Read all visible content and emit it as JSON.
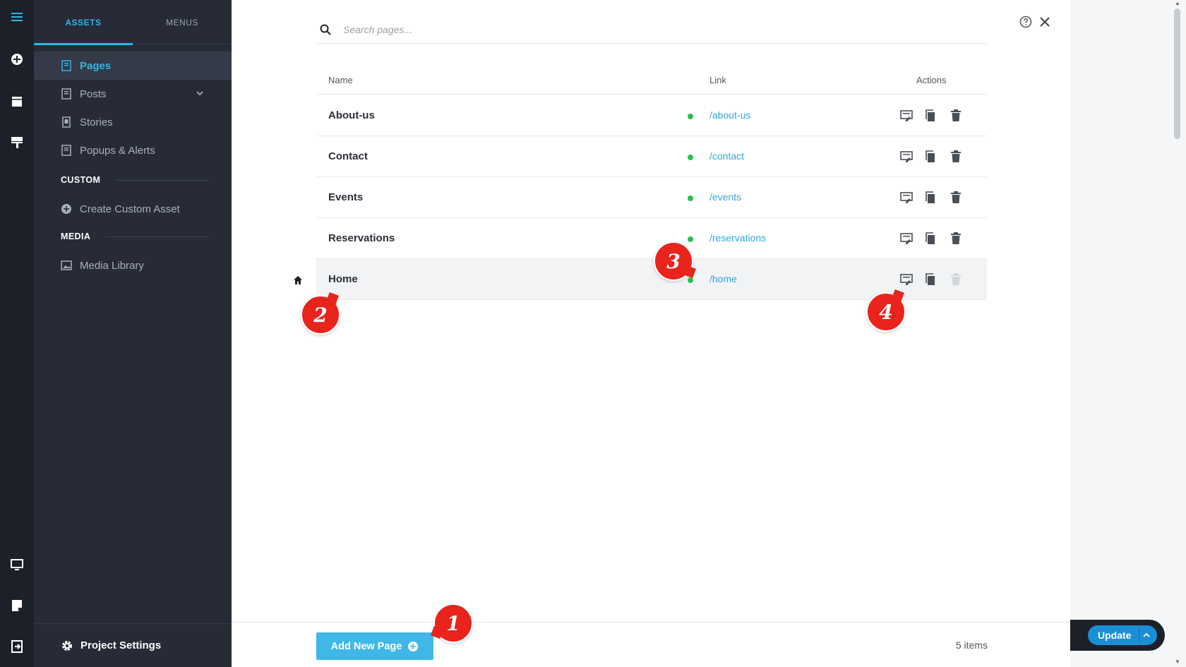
{
  "sidebar_rail": {
    "icons": [
      "menu-icon",
      "add-circle-icon",
      "page-icon",
      "paint-roller-icon",
      "desktop-icon",
      "note-icon",
      "exit-icon"
    ]
  },
  "assets_panel": {
    "tabs": [
      {
        "label": "ASSETS",
        "active": true
      },
      {
        "label": "MENUS",
        "active": false
      }
    ],
    "items": [
      {
        "label": "Pages",
        "active": true
      },
      {
        "label": "Posts",
        "expandable": true
      },
      {
        "label": "Stories"
      },
      {
        "label": "Popups & Alerts"
      }
    ],
    "custom_section": "CUSTOM",
    "custom_items": [
      {
        "label": "Create Custom Asset"
      }
    ],
    "media_section": "MEDIA",
    "media_items": [
      {
        "label": "Media Library"
      }
    ],
    "project_settings": "Project Settings"
  },
  "main": {
    "search": {
      "placeholder": "Search pages...",
      "value": ""
    },
    "columns": {
      "name": "Name",
      "link": "Link",
      "actions": "Actions"
    },
    "rows": [
      {
        "name": "About-us",
        "link": "/about-us",
        "status": "published",
        "delete_enabled": true
      },
      {
        "name": "Contact",
        "link": "/contact",
        "status": "published",
        "delete_enabled": true
      },
      {
        "name": "Events",
        "link": "/events",
        "status": "published",
        "delete_enabled": true
      },
      {
        "name": "Reservations",
        "link": "/reservations",
        "status": "published",
        "delete_enabled": true
      },
      {
        "name": "Home",
        "link": "/home",
        "status": "published",
        "home": true,
        "delete_enabled": false
      }
    ],
    "add_button": "Add New Page",
    "item_count": "5 items"
  },
  "update_button": "Update",
  "callouts": [
    "1",
    "2",
    "3",
    "4"
  ],
  "colors": {
    "accent": "#31b5e6",
    "link": "#31a8dc",
    "status_dot": "#27c24c",
    "callout": "#e8241d",
    "panel_bg": "#262b36",
    "rail_bg": "#1c2028"
  }
}
